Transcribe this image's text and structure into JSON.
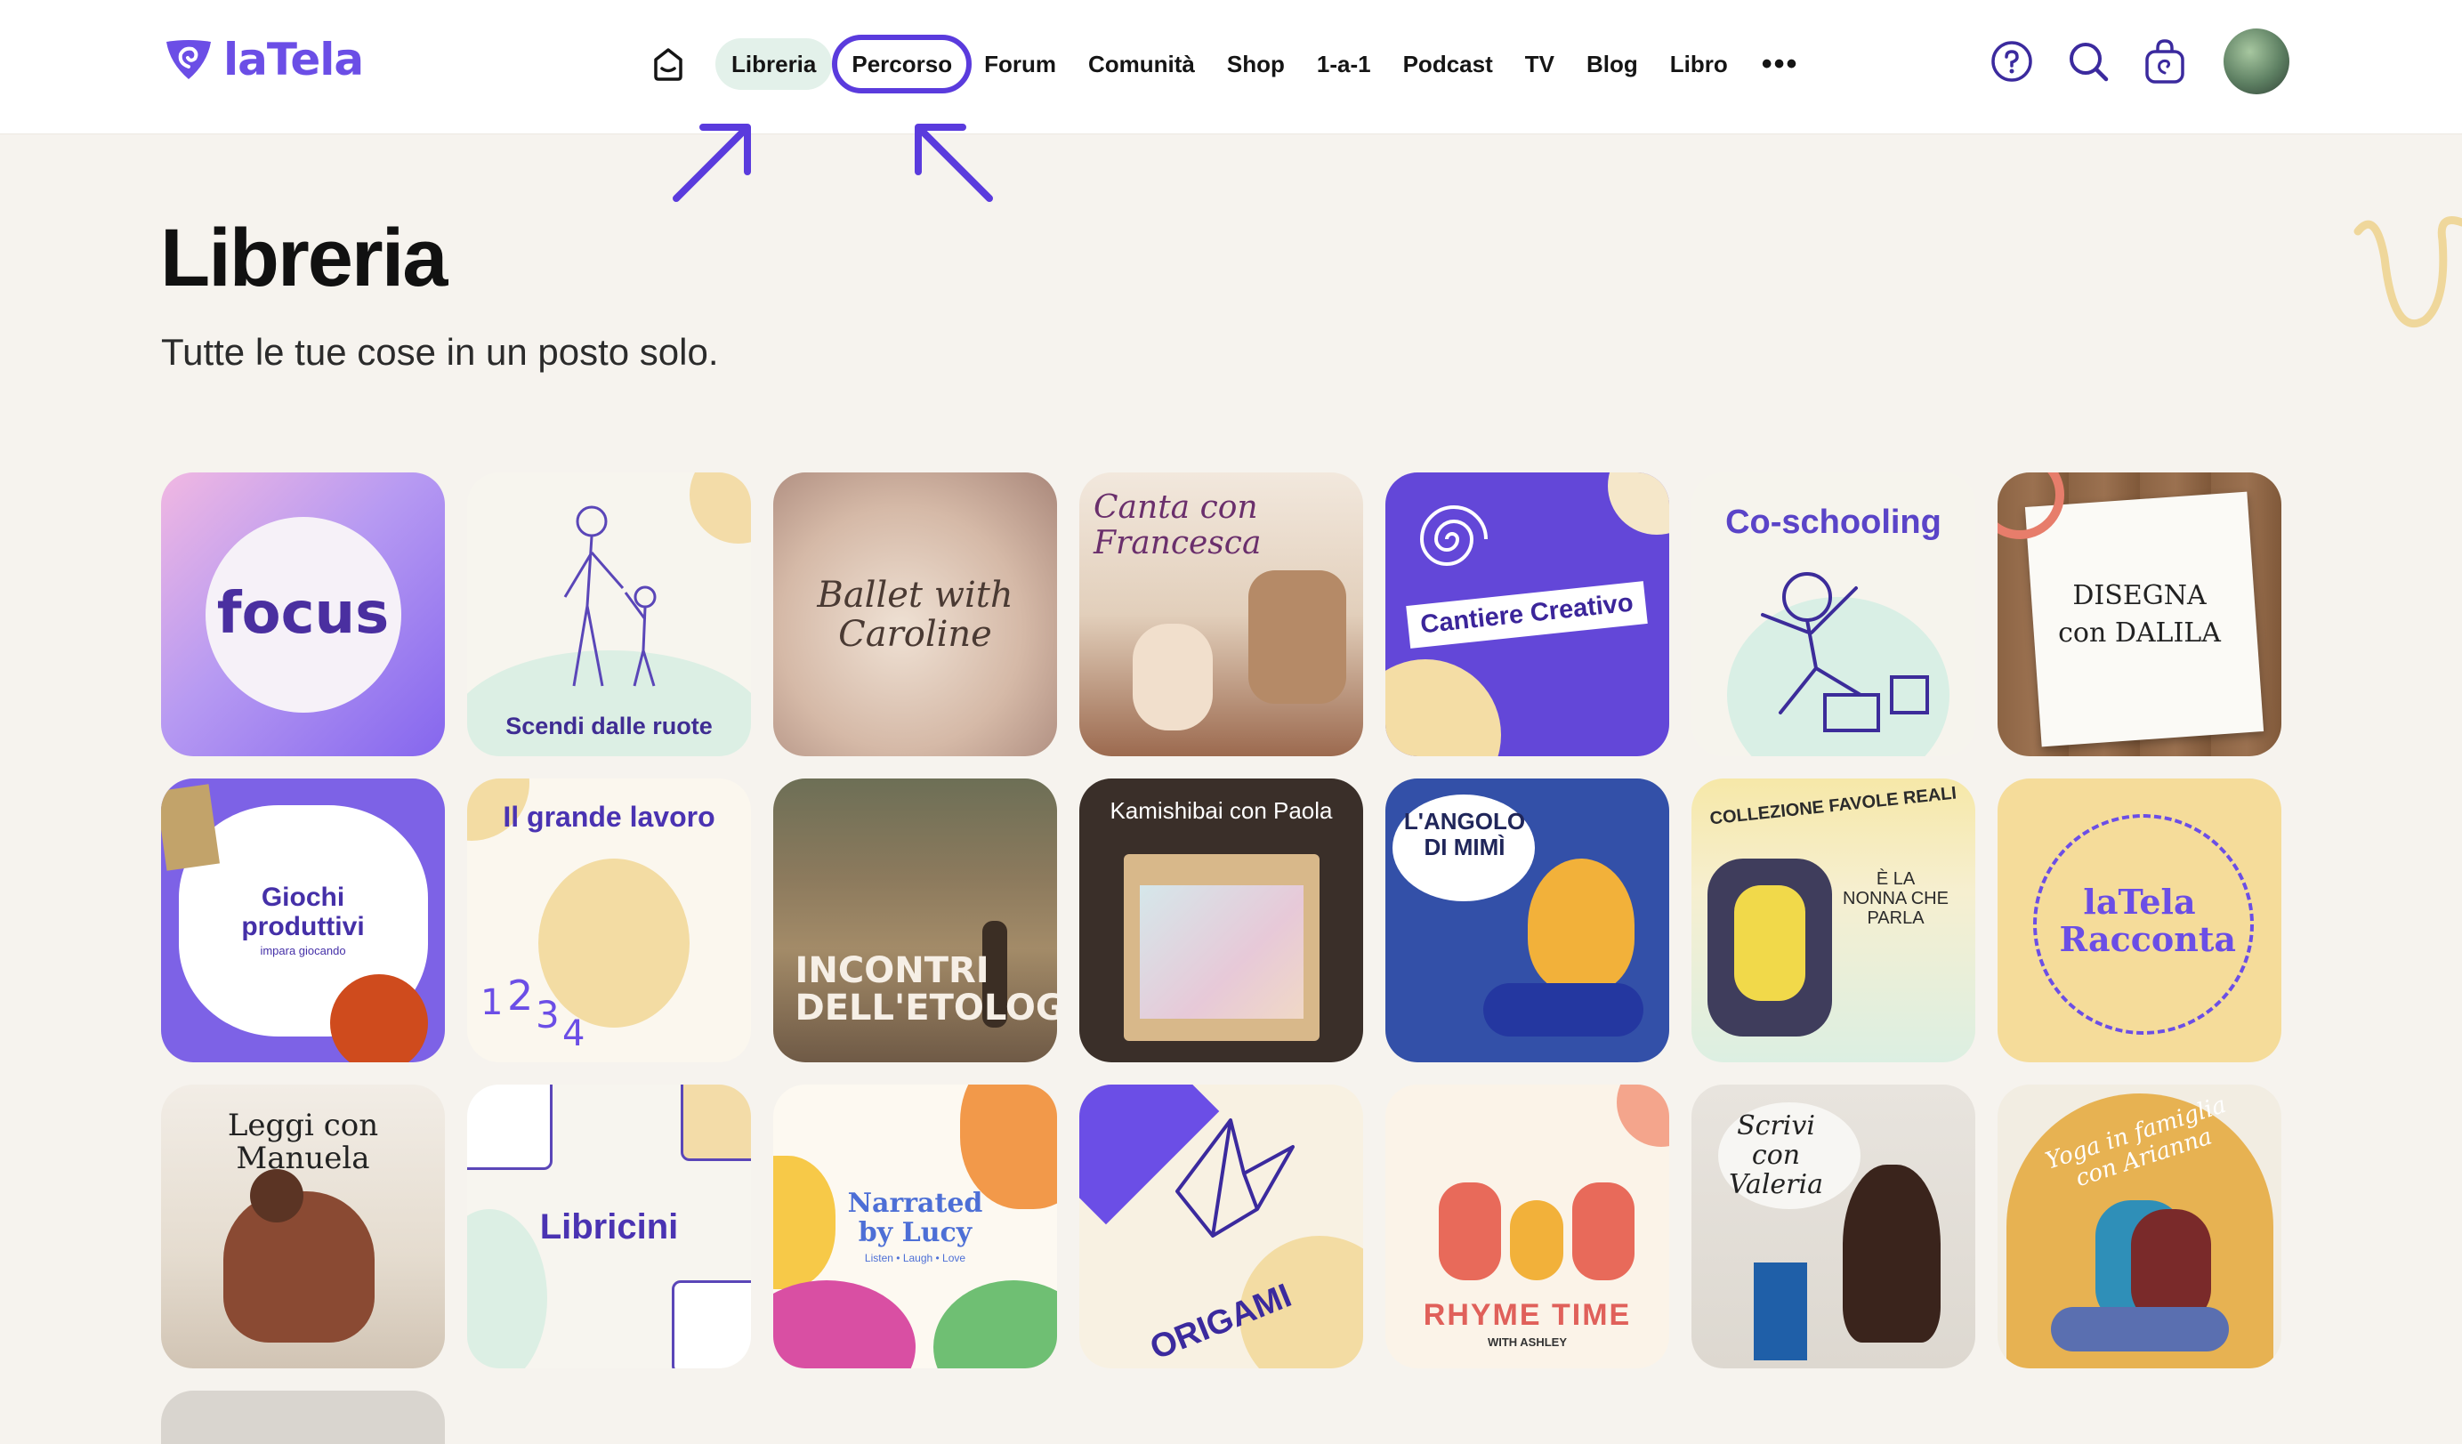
{
  "header": {
    "logo_text": "laTela",
    "nav": [
      {
        "label": "Libreria",
        "state": "active"
      },
      {
        "label": "Percorso",
        "state": "circled"
      },
      {
        "label": "Forum"
      },
      {
        "label": "Comunità"
      },
      {
        "label": "Shop"
      },
      {
        "label": "1-a-1"
      },
      {
        "label": "Podcast"
      },
      {
        "label": "TV"
      },
      {
        "label": "Blog"
      },
      {
        "label": "Libro"
      }
    ],
    "more_label": "•••",
    "icons": [
      "home-icon",
      "help-icon",
      "search-icon",
      "bag-icon"
    ]
  },
  "page": {
    "title": "Libreria",
    "subtitle": "Tutte le tue cose in un posto solo."
  },
  "tiles": [
    {
      "label": "focus",
      "bg": "#a88ef0"
    },
    {
      "label": "Scendi dalle ruote",
      "bg": "#f7f5ee"
    },
    {
      "label": "Ballet with Caroline",
      "bg": "#d8c5b8"
    },
    {
      "label": "Canta con Francesca",
      "bg": "#e8dccf"
    },
    {
      "label": "Cantiere Creativo",
      "bg": "#6347d8"
    },
    {
      "label": "Co-schooling",
      "bg": "#f6f4ed"
    },
    {
      "label": "DISEGNA con DALILA",
      "bg": "#8b6343"
    },
    {
      "label": "Giochi produttivi",
      "sublabel": "impara giocando",
      "bg": "#ffffff"
    },
    {
      "label": "Il grande lavoro",
      "bg": "#fbf7ee"
    },
    {
      "label": "INCONTRI DELL'ETOLOGA",
      "bg": "#7d6a55"
    },
    {
      "label": "Kamishibai con Paola",
      "bg": "#3a2f29"
    },
    {
      "label": "L'ANGOLO DI MIMÌ",
      "bg": "#3350a8"
    },
    {
      "label": "COLLEZIONE FAVOLE REALI",
      "sublabel": "È LA NONNA CHE PARLA",
      "bg": "#f6e8a8"
    },
    {
      "label": "laTela Racconta",
      "bg": "#f5dc9a"
    },
    {
      "label": "Leggi con Manuela",
      "bg": "#ece5dc"
    },
    {
      "label": "Libricini",
      "bg": "#f7f5ef"
    },
    {
      "label": "Narrated by Lucy",
      "sublabel": "Listen • Laugh • Love",
      "bg": "#fdf9f1"
    },
    {
      "label": "ORIGAMI",
      "bg": "#f8f1e2"
    },
    {
      "label": "RHYME TIME",
      "sublabel": "WITH ASHLEY",
      "bg": "#fbf3e8"
    },
    {
      "label": "Scrivi con Valeria",
      "bg": "#e6e2dc"
    },
    {
      "label": "Yoga in famiglia con Arianna",
      "bg": "#e7b252"
    }
  ],
  "colors": {
    "brand": "#6b4ee6",
    "annotation": "#5a3bdd",
    "active_nav_bg": "#e3f1ea",
    "page_bg": "#f6f3ee"
  }
}
